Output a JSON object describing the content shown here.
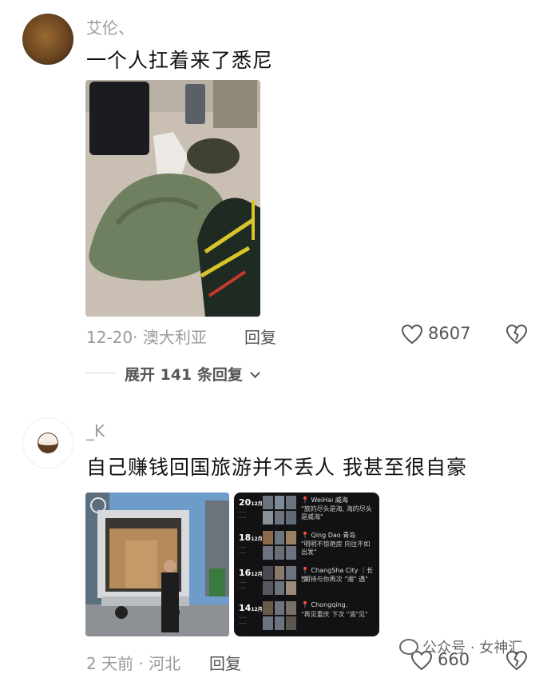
{
  "comments": [
    {
      "username": "艾伦、",
      "text": "一个人扛着来了悉尼",
      "meta": "12-20· 澳大利亚",
      "reply_label": "回复",
      "likes": "8607",
      "expand_label": "展开 141 条回复",
      "photo_desc": "luggage at airport"
    },
    {
      "username": "_K",
      "text": "自己赚钱回国旅游并不丢人 我甚至很自豪",
      "meta": "2 天前 · 河北",
      "reply_label": "回复",
      "likes": "660",
      "trip_card": {
        "rows": [
          {
            "day": "20",
            "month": "12月",
            "city": "WeiHai 威海",
            "caption": "\"旅的尽头是海, 海的尽头是威海\""
          },
          {
            "day": "18",
            "month": "12月",
            "city": "Qing Dao 青岛",
            "caption": "\"明明不惊艳房 向往不如出发\""
          },
          {
            "day": "16",
            "month": "12月",
            "city": "ChangSha City ｜长沙",
            "caption": "\"期待与你再次 \"湘\" 遇\""
          },
          {
            "day": "14",
            "month": "12月",
            "city": "Chongqing.",
            "caption": "\"再见重庆 下次 \"渝\"见\""
          }
        ]
      }
    }
  ],
  "watermark": "公众号 · 女神汇",
  "colors": {
    "accent_text": "#111111",
    "meta": "#9a9a9a",
    "dark_card": "#121214"
  }
}
